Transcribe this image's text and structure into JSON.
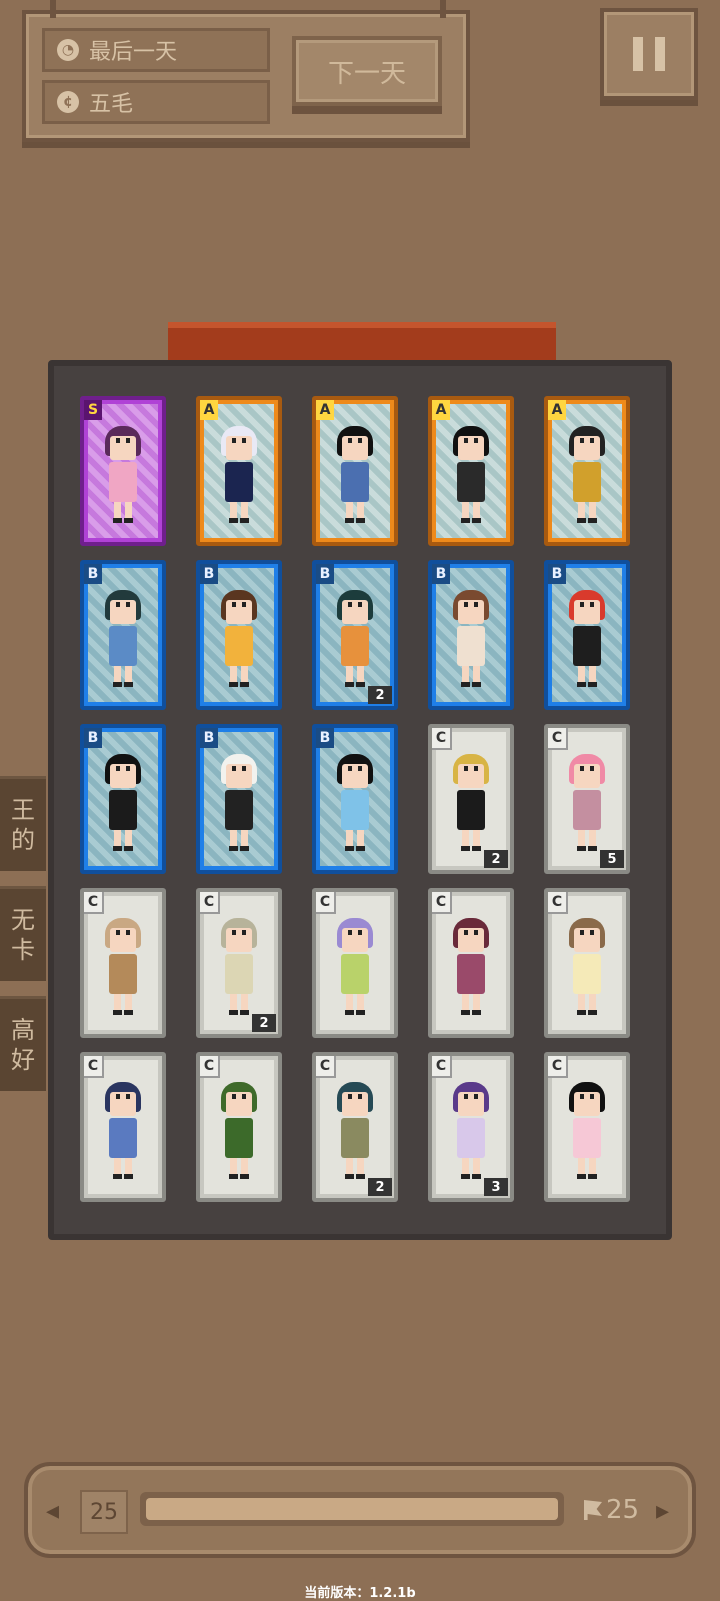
{
  "status": {
    "day_text": "最后一天",
    "money_text": "五毛",
    "next_day_label": "下一天"
  },
  "side_tabs": [
    {
      "label_top": "王",
      "label_bottom": "的"
    },
    {
      "label_top": "无",
      "label_bottom": "卡"
    },
    {
      "label_top": "高",
      "label_bottom": "好"
    }
  ],
  "cards": [
    {
      "rank": "S",
      "count": "",
      "hair": "#5a2a5a",
      "outfit": "#f0a6c4"
    },
    {
      "rank": "A",
      "count": "",
      "hair": "#e9e9f5",
      "outfit": "#1b2550"
    },
    {
      "rank": "A",
      "count": "",
      "hair": "#111111",
      "outfit": "#4b6fb0"
    },
    {
      "rank": "A",
      "count": "",
      "hair": "#111111",
      "outfit": "#2a2a2a"
    },
    {
      "rank": "A",
      "count": "",
      "hair": "#222222",
      "outfit": "#d1a02c"
    },
    {
      "rank": "B",
      "count": "",
      "hair": "#223a3c",
      "outfit": "#5b8bc6"
    },
    {
      "rank": "B",
      "count": "",
      "hair": "#5a3620",
      "outfit": "#f2b23c"
    },
    {
      "rank": "B",
      "count": "2",
      "hair": "#1c3c3c",
      "outfit": "#e7913c"
    },
    {
      "rank": "B",
      "count": "",
      "hair": "#7a4a30",
      "outfit": "#efe0d0"
    },
    {
      "rank": "B",
      "count": "",
      "hair": "#d93a2c",
      "outfit": "#1e1e1e"
    },
    {
      "rank": "B",
      "count": "",
      "hair": "#111111",
      "outfit": "#1b1b1b"
    },
    {
      "rank": "B",
      "count": "",
      "hair": "#f2f2ee",
      "outfit": "#222222"
    },
    {
      "rank": "B",
      "count": "",
      "hair": "#111111",
      "outfit": "#7fc2e8"
    },
    {
      "rank": "C",
      "count": "2",
      "hair": "#d8b445",
      "outfit": "#1b1b1b"
    },
    {
      "rank": "C",
      "count": "5",
      "hair": "#f08aa6",
      "outfit": "#c48fa0"
    },
    {
      "rank": "C",
      "count": "",
      "hair": "#c9a883",
      "outfit": "#b48a5a"
    },
    {
      "rank": "C",
      "count": "2",
      "hair": "#b7b39a",
      "outfit": "#dcd6b4"
    },
    {
      "rank": "C",
      "count": "",
      "hair": "#9a8ad2",
      "outfit": "#b9d26a"
    },
    {
      "rank": "C",
      "count": "",
      "hair": "#6a2a3a",
      "outfit": "#9a4a6a"
    },
    {
      "rank": "C",
      "count": "",
      "hair": "#8a6a4a",
      "outfit": "#f5eab8"
    },
    {
      "rank": "C",
      "count": "",
      "hair": "#2a3560",
      "outfit": "#5a7ac0"
    },
    {
      "rank": "C",
      "count": "",
      "hair": "#3f6a2a",
      "outfit": "#3c6a2a"
    },
    {
      "rank": "C",
      "count": "2",
      "hair": "#264a55",
      "outfit": "#8a8a60"
    },
    {
      "rank": "C",
      "count": "3",
      "hair": "#5a3a8a",
      "outfit": "#d8c8ea"
    },
    {
      "rank": "C",
      "count": "",
      "hair": "#111111",
      "outfit": "#f6c8d6"
    }
  ],
  "bottom_bar": {
    "current_level": "25",
    "target_level": "25",
    "progress": 1.0
  },
  "version_text": "当前版本：1.2.1b"
}
